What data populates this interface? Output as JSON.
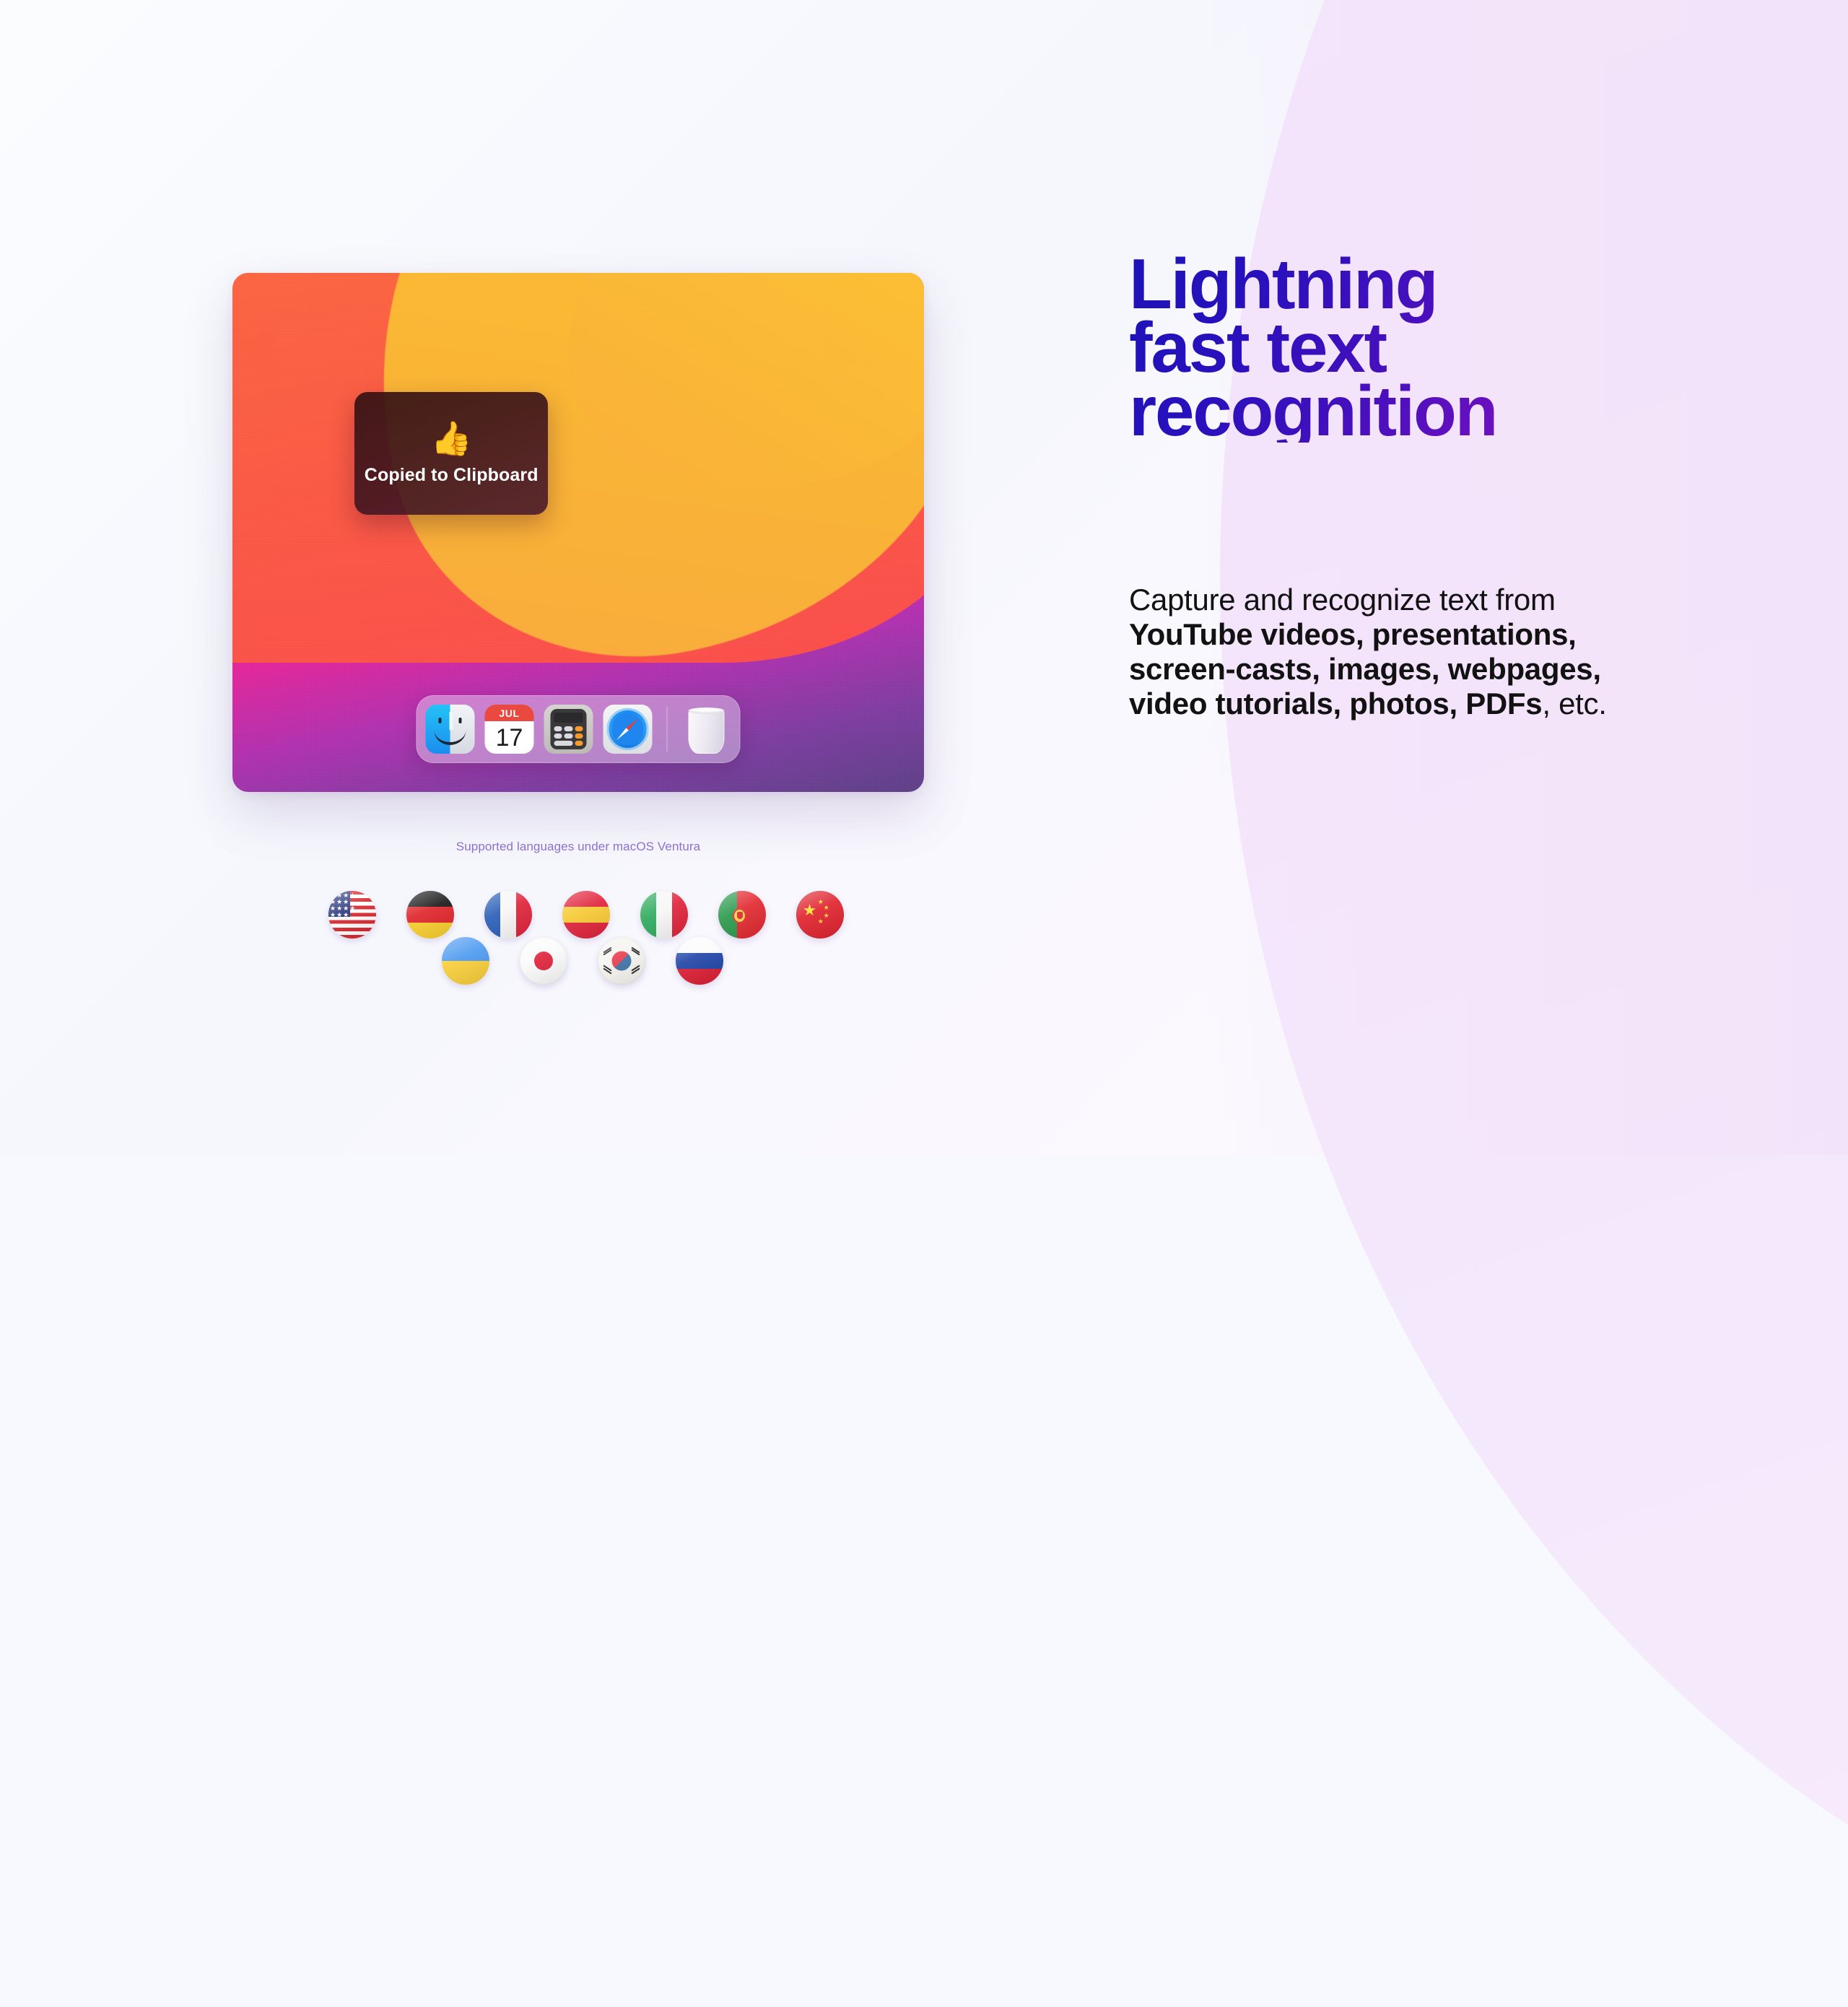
{
  "page": {
    "background_left": "#f7f9fe",
    "background_right": "#f3e4fb",
    "accent_gradient_start": "#1c12b8",
    "accent_gradient_end": "#9310c2"
  },
  "headline": {
    "line1": "Lightning",
    "line2": "fast text",
    "line3": "recognition"
  },
  "body_copy": {
    "segments": [
      {
        "text": "Capture and recognize text from ",
        "bold": false
      },
      {
        "text": "YouTube videos, presentations, screen-casts, images, webpages, video tutorials, photos, PDFs",
        "bold": true
      },
      {
        "text": ", etc.",
        "bold": false
      }
    ],
    "plain": "Capture and recognize text from YouTube videos, presentations, screen-casts, images, webpages, video tutorials, photos, PDFs, etc."
  },
  "mockup": {
    "toast": {
      "emoji": "👍",
      "emoji_name": "thumbs-up-emoji",
      "label": "Copied to Clipboard",
      "background": "#341212",
      "text_color": "#ffffff"
    },
    "dock": {
      "items": [
        {
          "name": "finder",
          "label": "Finder",
          "running": true
        },
        {
          "name": "calendar",
          "label": "Calendar",
          "month": "JUL",
          "day": "17",
          "running": false
        },
        {
          "name": "calculator",
          "label": "Calculator",
          "running": false
        },
        {
          "name": "safari",
          "label": "Safari",
          "running": false
        }
      ],
      "separator": true,
      "trash": {
        "name": "trash",
        "label": "Trash"
      }
    },
    "wallpaper": {
      "name": "macos-big-sur-wallpaper",
      "colors": [
        "#fcc02e",
        "#fa5742",
        "#f41d67",
        "#b02fae",
        "#5c3f86"
      ]
    }
  },
  "languages": {
    "caption": "Supported languages under macOS Ventura",
    "caption_color": "#8f6fd0",
    "row1": [
      {
        "code": "us",
        "label": "United States"
      },
      {
        "code": "de",
        "label": "Germany"
      },
      {
        "code": "fr",
        "label": "France"
      },
      {
        "code": "es",
        "label": "Spain"
      },
      {
        "code": "it",
        "label": "Italy"
      },
      {
        "code": "pt",
        "label": "Portugal"
      },
      {
        "code": "cn",
        "label": "China"
      }
    ],
    "row2": [
      {
        "code": "ua",
        "label": "Ukraine"
      },
      {
        "code": "jp",
        "label": "Japan"
      },
      {
        "code": "kr",
        "label": "South Korea"
      },
      {
        "code": "ru",
        "label": "Russia"
      }
    ]
  }
}
